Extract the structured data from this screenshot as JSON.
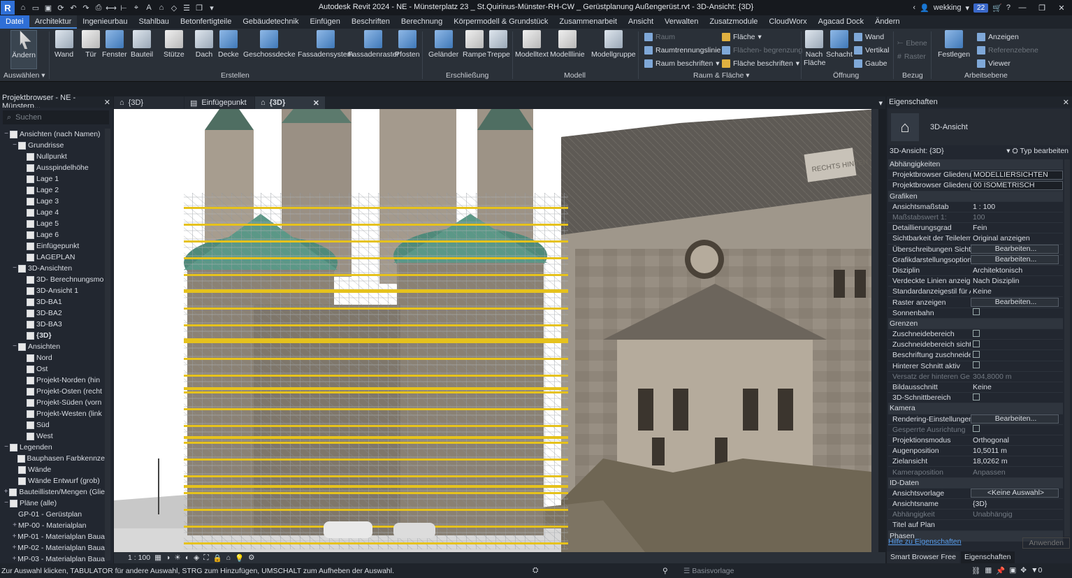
{
  "titlebar": {
    "logo": "R",
    "title": "Autodesk Revit 2024 - NE - Münsterplatz 23 _ St.Quirinus-Münster-RH-CW _ Gerüstplanung Außengerüst.rvt - 3D-Ansicht: {3D}",
    "user": "wekking",
    "notifications": "22"
  },
  "ribbon_tabs": [
    "Datei",
    "Architektur",
    "Ingenieurbau",
    "Stahlbau",
    "Betonfertigteile",
    "Gebäudetechnik",
    "Einfügen",
    "Beschriften",
    "Berechnung",
    "Körpermodell & Grundstück",
    "Zusammenarbeit",
    "Ansicht",
    "Verwalten",
    "Zusatzmodule",
    "CloudWorx",
    "Agacad Dock",
    "Ändern"
  ],
  "ribbon": {
    "aendern": "Ändern",
    "auswaehlen": "Auswählen",
    "create": [
      "Wand",
      "Tür",
      "Fenster",
      "Bauteil",
      "Stütze",
      "Dach",
      "Decke",
      "Geschossdecke",
      "Fassadensystem",
      "Fassadenraster",
      "Pfosten"
    ],
    "circulation": [
      "Geländer",
      "Rampe",
      "Treppe"
    ],
    "model": [
      "Modelltext",
      "Modelllinie",
      "Modellgruppe"
    ],
    "groups": {
      "select": "Auswählen",
      "create": "Erstellen",
      "circulation": "Erschließung",
      "model": "Modell",
      "room": "Raum & Fläche",
      "opening": "Öffnung",
      "datum": "Bezug",
      "workplane": "Arbeitsebene"
    },
    "room": {
      "raum": "Raum",
      "trennung": "Raumtrennungslinie",
      "beschriften": "Raum  beschriften",
      "flaeche": "Fläche",
      "begrenzung": "Flächen- begrenzung",
      "flaeche_beschriften": "Fläche  beschriften"
    },
    "opening": {
      "nach_flaeche": "Nach Fläche",
      "schacht": "Schacht",
      "wand": "Wand",
      "vertikal": "Vertikal",
      "gaube": "Gaube"
    },
    "datum": {
      "ebene": "Ebene",
      "raster": "Raster"
    },
    "workplane": {
      "festlegen": "Festlegen",
      "anzeigen": "Anzeigen",
      "referenzebene": "Referenzebene",
      "viewer": "Viewer"
    }
  },
  "project_browser": {
    "title": "Projektbrowser - NE - Münsterp...",
    "search_placeholder": "Suchen",
    "nodes": [
      {
        "label": "Ansichten (nach Namen)",
        "level": 0,
        "toggle": "−"
      },
      {
        "label": "Grundrisse",
        "level": 1,
        "toggle": "−"
      },
      {
        "label": "Nullpunkt",
        "level": 2
      },
      {
        "label": "Ausspindelhöhe",
        "level": 2
      },
      {
        "label": "Lage 1",
        "level": 2
      },
      {
        "label": "Lage 2",
        "level": 2
      },
      {
        "label": "Lage 3",
        "level": 2
      },
      {
        "label": "Lage 4",
        "level": 2
      },
      {
        "label": "Lage 5",
        "level": 2
      },
      {
        "label": "Lage 6",
        "level": 2
      },
      {
        "label": "Einfügepunkt",
        "level": 2
      },
      {
        "label": "LAGEPLAN",
        "level": 2
      },
      {
        "label": "3D-Ansichten",
        "level": 1,
        "toggle": "−"
      },
      {
        "label": "3D- Berechnungsmo",
        "level": 2
      },
      {
        "label": "3D-Ansicht 1",
        "level": 2
      },
      {
        "label": "3D-BA1",
        "level": 2
      },
      {
        "label": "3D-BA2",
        "level": 2
      },
      {
        "label": "3D-BA3",
        "level": 2
      },
      {
        "label": "{3D}",
        "level": 2,
        "bold": true
      },
      {
        "label": "Ansichten",
        "level": 1,
        "toggle": "−"
      },
      {
        "label": "Nord",
        "level": 2
      },
      {
        "label": "Ost",
        "level": 2
      },
      {
        "label": "Projekt-Norden (hin",
        "level": 2
      },
      {
        "label": "Projekt-Osten (recht",
        "level": 2
      },
      {
        "label": "Projekt-Süden (vorn",
        "level": 2
      },
      {
        "label": "Projekt-Westen (link",
        "level": 2
      },
      {
        "label": "Süd",
        "level": 2
      },
      {
        "label": "West",
        "level": 2
      },
      {
        "label": "Legenden",
        "level": 0,
        "toggle": "−"
      },
      {
        "label": "Bauphasen Farbkennze",
        "level": 1
      },
      {
        "label": "Wände",
        "level": 1
      },
      {
        "label": "Wände Entwurf (grob)",
        "level": 1
      },
      {
        "label": "Bauteillisten/Mengen (Glie",
        "level": 0,
        "toggle": "+"
      },
      {
        "label": "Pläne (alle)",
        "level": 0,
        "toggle": "−"
      },
      {
        "label": "GP-01 - Gerüstplan",
        "level": 1,
        "noicon": true
      },
      {
        "label": "MP-00 - Materialplan",
        "level": 1,
        "toggle": "+",
        "noicon": true
      },
      {
        "label": "MP-01 - Materialplan Baua",
        "level": 1,
        "toggle": "+",
        "noicon": true
      },
      {
        "label": "MP-02 - Materialplan Baua",
        "level": 1,
        "toggle": "+",
        "noicon": true
      },
      {
        "label": "MP-03 - Materialplan Baua",
        "level": 1,
        "toggle": "+",
        "noicon": true
      }
    ]
  },
  "view_tabs": [
    "{3D}",
    "Einfügepunkt",
    "{3D}"
  ],
  "canvas": {
    "sign_text": "RECHTS HINTEN"
  },
  "view_bar": {
    "scale": "1 : 100"
  },
  "properties": {
    "title": "Eigenschaften",
    "type_name": "3D-Ansicht",
    "instance": "3D-Ansicht: {3D}",
    "edit_type": "Typ bearbeiten",
    "rows": [
      {
        "sec": "Abhängigkeiten"
      },
      {
        "k": "Projektbrowser Gliederu...",
        "v": "MODELLIERSICHTEN",
        "t": "input"
      },
      {
        "k": "Projektbrowser Gliederu...",
        "v": "00 ISOMETRISCH",
        "t": "input"
      },
      {
        "sec": "Grafiken"
      },
      {
        "k": "Ansichtsmaßstab",
        "v": "1 : 100"
      },
      {
        "k": "Maßstabswert 1:",
        "v": "100",
        "dim": true
      },
      {
        "k": "Detaillierungsgrad",
        "v": "Fein"
      },
      {
        "k": "Sichtbarkeit der Teilelem...",
        "v": "Original anzeigen"
      },
      {
        "k": "Überschreibungen Sicht...",
        "v": "Bearbeiten...",
        "t": "btn"
      },
      {
        "k": "Grafikdarstellungsoption...",
        "v": "Bearbeiten...",
        "t": "btn"
      },
      {
        "k": "Disziplin",
        "v": "Architektonisch"
      },
      {
        "k": "Verdeckte Linien anzeigen",
        "v": "Nach Disziplin"
      },
      {
        "k": "Standardanzeigestil für A...",
        "v": "Keine"
      },
      {
        "k": "Raster anzeigen",
        "v": "Bearbeiten...",
        "t": "btn"
      },
      {
        "k": "Sonnenbahn",
        "v": "",
        "t": "cb"
      },
      {
        "sec": "Grenzen"
      },
      {
        "k": "Zuschneidebereich",
        "v": "",
        "t": "cb"
      },
      {
        "k": "Zuschneidebereich sicht...",
        "v": "",
        "t": "cb"
      },
      {
        "k": "Beschriftung zuschneiden",
        "v": "",
        "t": "cb"
      },
      {
        "k": "Hinterer Schnitt aktiv",
        "v": "",
        "t": "cb"
      },
      {
        "k": "Versatz der hinteren Ge...",
        "v": "304,8000 m",
        "dim": true
      },
      {
        "k": "Bildausschnitt",
        "v": "Keine"
      },
      {
        "k": "3D-Schnittbereich",
        "v": "",
        "t": "cb"
      },
      {
        "sec": "Kamera"
      },
      {
        "k": "Rendering-Einstellungen",
        "v": "Bearbeiten...",
        "t": "btn"
      },
      {
        "k": "Gesperrte Ausrichtung",
        "v": "",
        "t": "cb",
        "dim": true
      },
      {
        "k": "Projektionsmodus",
        "v": "Orthogonal"
      },
      {
        "k": "Augenposition",
        "v": "10,5011 m"
      },
      {
        "k": "Zielansicht",
        "v": "18,0262 m"
      },
      {
        "k": "Kameraposition",
        "v": "Anpassen",
        "dim": true
      },
      {
        "sec": "ID-Daten"
      },
      {
        "k": "Ansichtsvorlage",
        "v": "<Keine Auswahl>",
        "t": "btn"
      },
      {
        "k": "Ansichtsname",
        "v": "{3D}"
      },
      {
        "k": "Abhängigkeit",
        "v": "Unabhängig",
        "dim": true
      },
      {
        "k": "Titel auf Plan",
        "v": ""
      },
      {
        "sec": "Phasen"
      }
    ],
    "help_link": "Hilfe zu Eigenschaften",
    "apply": "Anwenden",
    "tabs": [
      "Smart Browser Free",
      "Eigenschaften"
    ]
  },
  "status": {
    "text": "Zur Auswahl klicken, TABULATOR für andere Auswahl, STRG zum Hinzufügen, UMSCHALT zum Aufheben der Auswahl.",
    "template": "Basisvorlage",
    "filter_count": "0"
  },
  "colors": {
    "accent": "#2f6fd6",
    "ribbon": "#2a3038",
    "panel": "#222730"
  }
}
